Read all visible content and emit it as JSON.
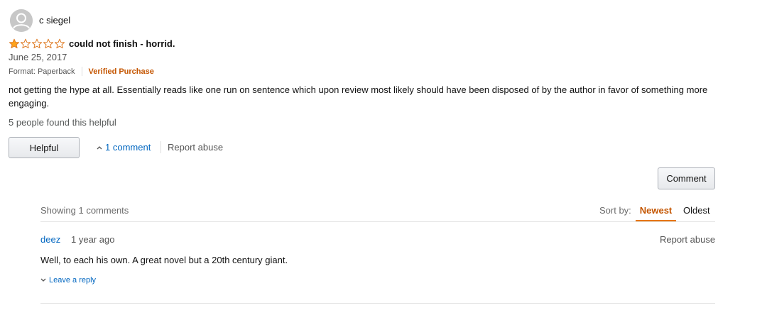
{
  "review": {
    "reviewer_name": "c siegel",
    "rating": 1,
    "max_rating": 5,
    "title": "could not finish - horrid.",
    "date": "June 25, 2017",
    "format": "Format: Paperback",
    "verified": "Verified Purchase",
    "body": "not getting the hype at all. Essentially reads like one run on sentence which upon review most likely should have been disposed of by the author in favor of something more engaging.",
    "helpful_count_text": "5 people found this helpful",
    "helpful_label": "Helpful",
    "comment_link": "1 comment",
    "report_abuse": "Report abuse"
  },
  "comments": {
    "comment_button": "Comment",
    "showing": "Showing 1 comments",
    "sort_by_label": "Sort by:",
    "sort_newest": "Newest",
    "sort_oldest": "Oldest",
    "items": [
      {
        "author": "deez",
        "time": "1 year ago",
        "report_abuse": "Report abuse",
        "text": "Well, to each his own. A great novel but a 20th century giant.",
        "reply_link": "Leave a reply"
      }
    ]
  },
  "colors": {
    "star_fill": "#ffa41c",
    "star_outline": "#de7921",
    "link": "#0066c0",
    "verified": "#c45500",
    "sort_active": "#c45500"
  },
  "icons": {
    "avatar": "user-avatar-icon",
    "star_filled": "star-filled-icon",
    "star_empty": "star-empty-icon",
    "chevron_up": "chevron-up-icon",
    "chevron_down": "chevron-down-icon"
  }
}
